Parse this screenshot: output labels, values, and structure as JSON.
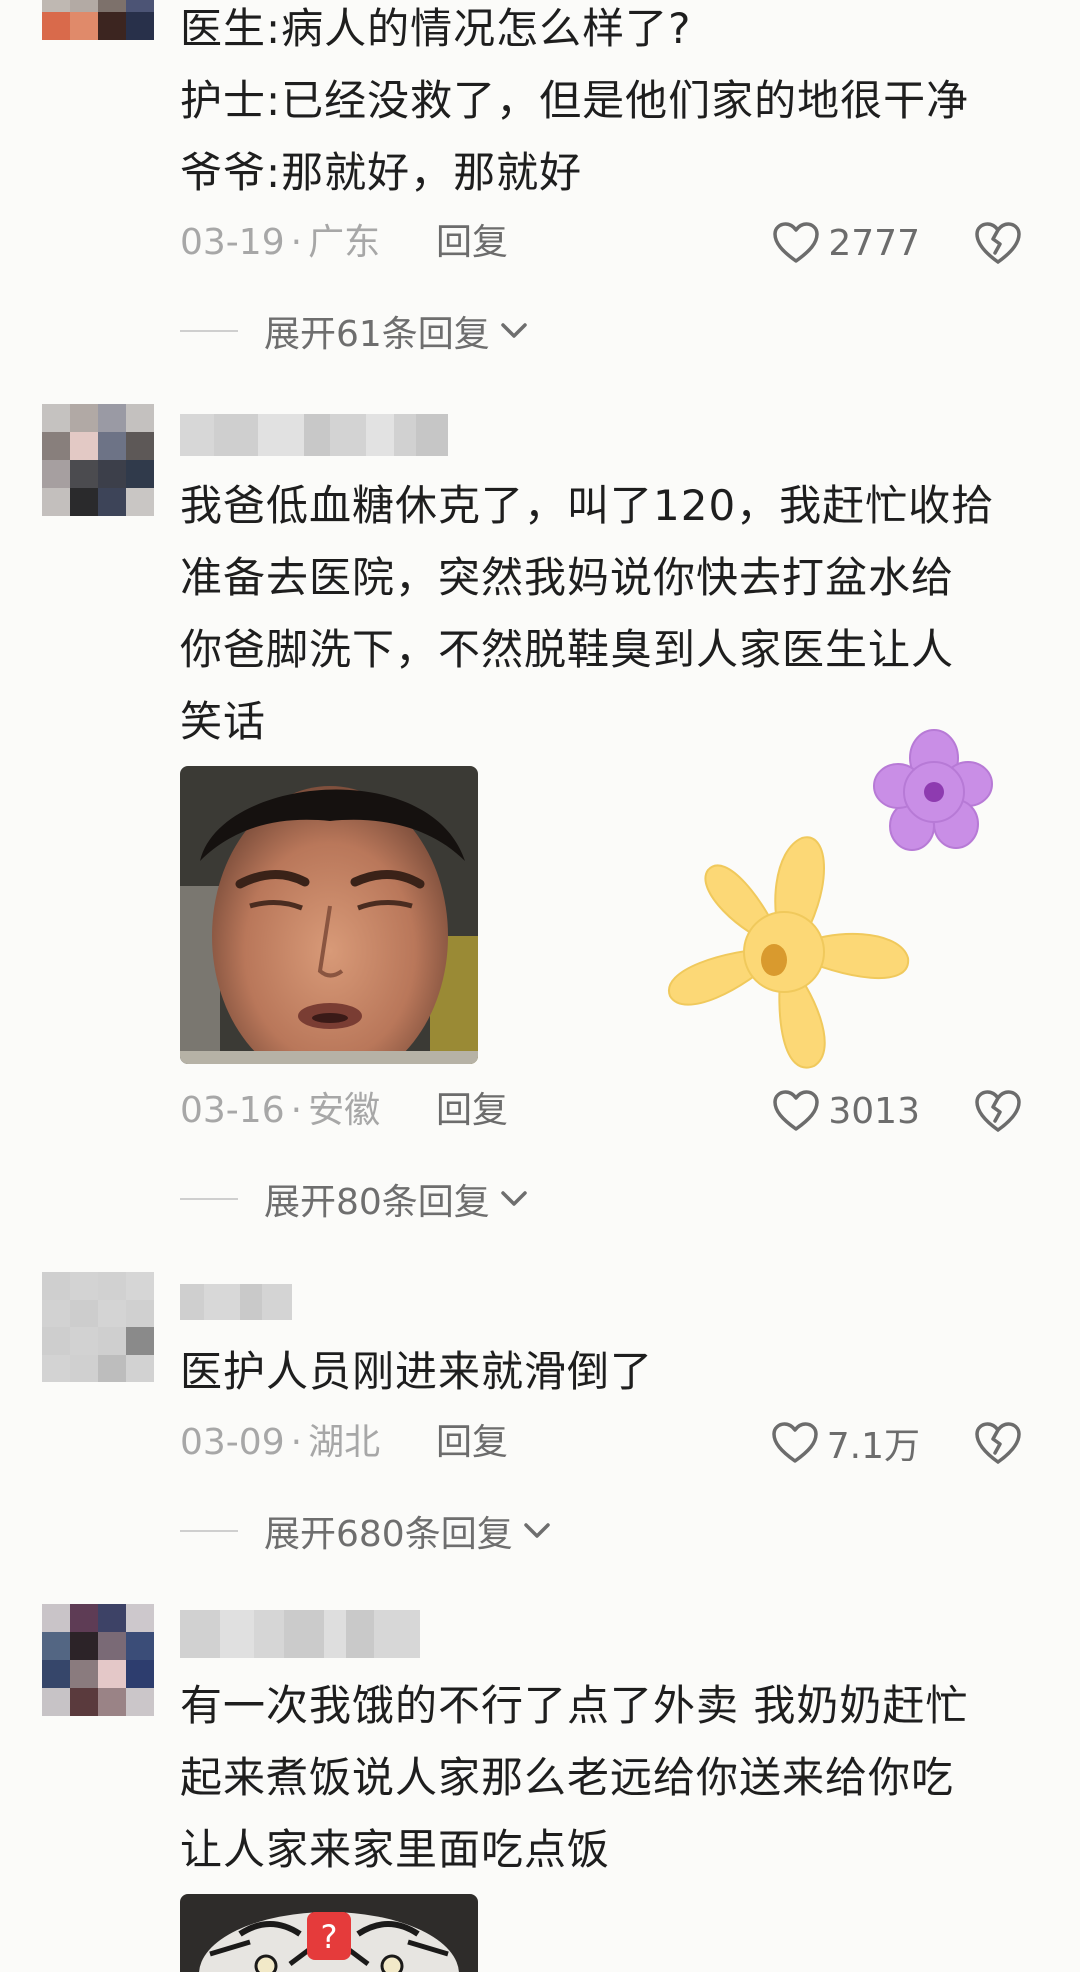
{
  "comments": [
    {
      "lines": [
        "医生:病人的情况怎么样了?",
        "护士:已经没救了，但是他们家的地很干净",
        "爷爷:那就好，那就好"
      ],
      "date": "03-19",
      "location": "广东",
      "reply_label": "回复",
      "likes": "2777",
      "expand_label": "展开61条回复",
      "avatar_colors": [
        "#d96a4b",
        "#7a3a2a",
        "#3c2520",
        "#28304a"
      ]
    },
    {
      "lines": [
        "我爸低血糖休克了，叫了120，我赶忙收拾",
        "准备去医院，突然我妈说你快去打盆水给",
        "你爸脚洗下，不然脱鞋臭到人家医生让人",
        "笑话"
      ],
      "date": "03-16",
      "location": "安徽",
      "reply_label": "回复",
      "likes": "3013",
      "expand_label": "展开80条回复",
      "sticker_icons": [
        "purple-flower-icon",
        "yellow-flower-icon"
      ]
    },
    {
      "lines": [
        "医护人员刚进来就滑倒了"
      ],
      "date": "03-09",
      "location": "湖北",
      "reply_label": "回复",
      "likes": "7.1万",
      "expand_label": "展开680条回复"
    },
    {
      "lines": [
        "有一次我饿的不行了点了外卖 我奶奶赶忙",
        "起来煮饭说人家那么老远给你送来给你吃",
        "让人家来家里面吃点饭"
      ],
      "sticker_badge": "?"
    }
  ],
  "colors": {
    "meta": "#a7a7a7",
    "text": "#1e1e1e",
    "background": "#fbfbf9"
  }
}
